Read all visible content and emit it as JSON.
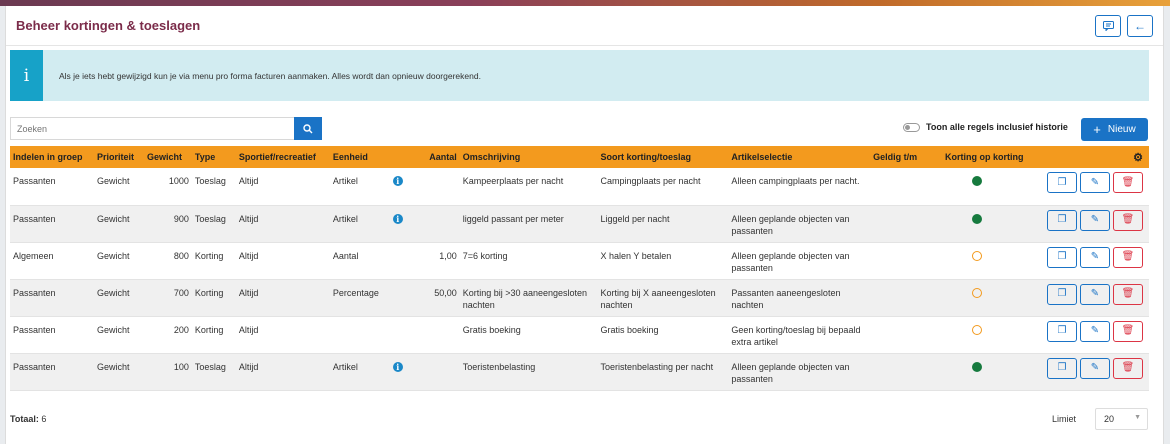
{
  "title": "Beheer kortingen & toeslagen",
  "info_icon": "i",
  "info_text": "Als je iets hebt gewijzigd kun je via menu pro forma facturen aanmaken. Alles wordt dan opnieuw doorgerekend.",
  "search": {
    "placeholder": "Zoeken"
  },
  "toggle_label": "Toon alle regels inclusief historie",
  "new_button": "Nieuw",
  "columns": [
    "Indelen in groep",
    "Prioriteit",
    "Gewicht",
    "Type",
    "Sportief/recreatief",
    "Eenheid",
    "",
    "Aantal",
    "Omschrijving",
    "Soort korting/toeslag",
    "Artikelselectie",
    "Geldig t/m",
    "Korting op korting",
    ""
  ],
  "rows": [
    {
      "groep": "Passanten",
      "prioriteit": "Gewicht",
      "gewicht": "1000",
      "type": "Toeslag",
      "sport": "Altijd",
      "eenheid": "Artikel",
      "info": true,
      "aantal": "",
      "omschrijving": "Kampeerplaats per nacht",
      "soort": "Campingplaats per nacht",
      "artikel": "Alleen campingplaats per nacht.",
      "geldig": "",
      "kok": "filled"
    },
    {
      "groep": "Passanten",
      "prioriteit": "Gewicht",
      "gewicht": "900",
      "type": "Toeslag",
      "sport": "Altijd",
      "eenheid": "Artikel",
      "info": true,
      "aantal": "",
      "omschrijving": "liggeld passant per meter",
      "soort": "Liggeld per nacht",
      "artikel": "Alleen geplande objecten van passanten",
      "geldig": "",
      "kok": "filled"
    },
    {
      "groep": "Algemeen",
      "prioriteit": "Gewicht",
      "gewicht": "800",
      "type": "Korting",
      "sport": "Altijd",
      "eenheid": "Aantal",
      "info": false,
      "aantal": "1,00",
      "omschrijving": "7=6 korting",
      "soort": "X halen Y betalen",
      "artikel": "Alleen geplande objecten van passanten",
      "geldig": "",
      "kok": "empty"
    },
    {
      "groep": "Passanten",
      "prioriteit": "Gewicht",
      "gewicht": "700",
      "type": "Korting",
      "sport": "Altijd",
      "eenheid": "Percentage",
      "info": false,
      "aantal": "50,00",
      "omschrijving": "Korting bij >30 aaneengesloten nachten",
      "soort": "Korting bij X aaneengesloten nachten",
      "artikel": "Passanten aaneengesloten nachten",
      "geldig": "",
      "kok": "empty"
    },
    {
      "groep": "Passanten",
      "prioriteit": "Gewicht",
      "gewicht": "200",
      "type": "Korting",
      "sport": "Altijd",
      "eenheid": "",
      "info": false,
      "aantal": "",
      "omschrijving": "Gratis boeking",
      "soort": "Gratis boeking",
      "artikel": "Geen korting/toeslag bij bepaald extra artikel",
      "geldig": "",
      "kok": "empty"
    },
    {
      "groep": "Passanten",
      "prioriteit": "Gewicht",
      "gewicht": "100",
      "type": "Toeslag",
      "sport": "Altijd",
      "eenheid": "Artikel",
      "info": true,
      "aantal": "",
      "omschrijving": "Toeristenbelasting",
      "soort": "Toeristenbelasting per nacht",
      "artikel": "Alleen geplande objecten van passanten",
      "geldig": "",
      "kok": "filled"
    }
  ],
  "footer": {
    "total_label": "Totaal:",
    "total_value": "6",
    "limit_label": "Limiet",
    "limit_value": "20"
  },
  "colors": {
    "accent": "#1a73c6",
    "header_orange": "#f39a1e",
    "title": "#7b2c4a",
    "info_bg": "#d2ecf1",
    "danger": "#dc3545",
    "active_dot": "#167a3e"
  }
}
